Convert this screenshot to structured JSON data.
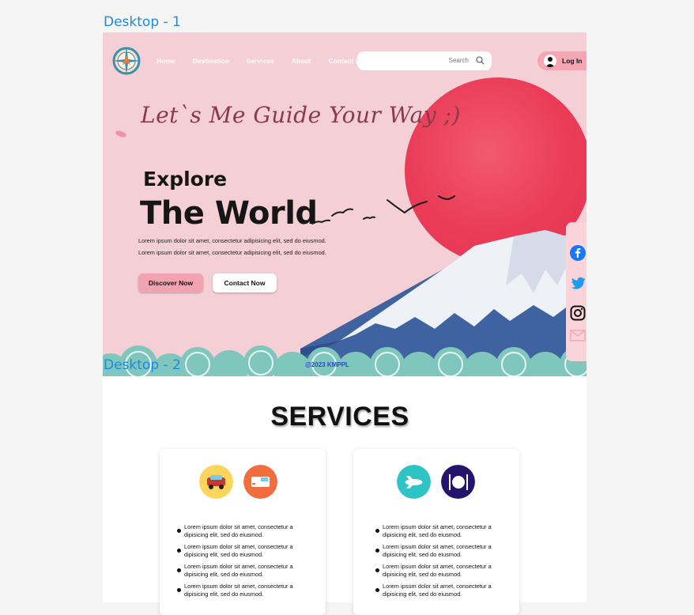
{
  "frames": {
    "label1": "Desktop - 1",
    "label2": "Desktop - 2"
  },
  "nav": {
    "items": [
      "Home",
      "Destination",
      "Services",
      "About",
      "Contact Us"
    ]
  },
  "search": {
    "placeholder": "Search"
  },
  "login": {
    "label": "Log In"
  },
  "hero": {
    "tagline": "Let`s Me Guide Your Way ;)",
    "explore": "Explore",
    "world": "The World",
    "desc1": "Lorem ipsum dolor sit amet, consectetur adipisicing elit, sed do eiusmod.",
    "desc2": "Lorem ipsum dolor sit amet, consectetur adipisicing elit, sed do eiusmod.",
    "discover_label": "Discover Now",
    "contact_label": "Contact Now"
  },
  "social": {
    "icons": [
      "facebook-icon",
      "twitter-icon",
      "instagram-icon",
      "mail-icon"
    ]
  },
  "copyright": "@2023 KMPPL",
  "services": {
    "title": "SERVICES",
    "cards": [
      {
        "icons": [
          "car-icon",
          "bus-icon"
        ],
        "items": [
          "Lorem ipsum dolor sit amet, consectetur a dipisicing elit, sed do eiusmod.",
          "Lorem ipsum dolor sit amet, consectetur a dipisicing elit, sed do eiusmod.",
          "Lorem ipsum dolor sit amet, consectetur a dipisicing elit, sed do eiusmod.",
          "Lorem ipsum dolor sit amet, consectetur a dipisicing elit, sed do eiusmod."
        ]
      },
      {
        "icons": [
          "airplane-icon",
          "dining-icon"
        ],
        "items": [
          "Lorem ipsum dolor sit amet, consectetur a dipisicing elit, sed do eiusmod.",
          "Lorem ipsum dolor sit amet, consectetur a dipisicing elit, sed do eiusmod.",
          "Lorem ipsum dolor sit amet, consectetur a dipisicing elit, sed do eiusmod.",
          "Lorem ipsum dolor sit amet, consectetur a dipisicing elit, sed do eiusmod."
        ]
      }
    ]
  },
  "colors": {
    "hero_bg": "#f4cfd6",
    "sun": "#ea3b57",
    "mountain": "#3f63a0",
    "accent_button": "#f2a3af",
    "link_blue": "#2548c9"
  }
}
